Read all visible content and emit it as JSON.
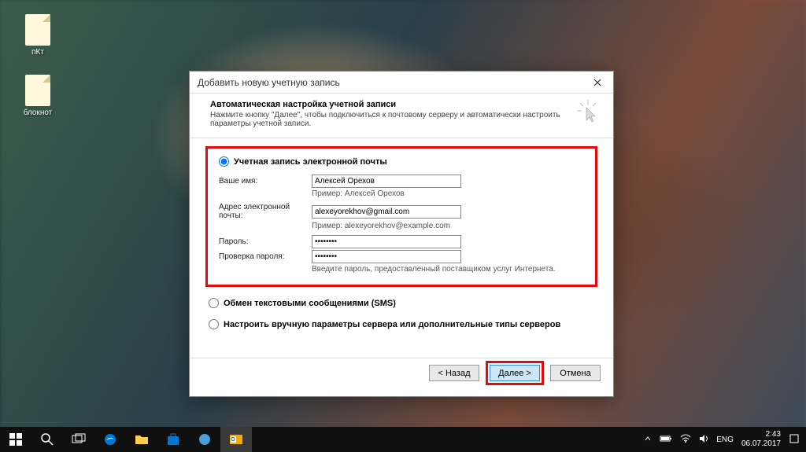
{
  "desktop": {
    "icons": [
      "пКт",
      "блокнот"
    ]
  },
  "dialog": {
    "title": "Добавить новую учетную запись",
    "header_title": "Автоматическая настройка учетной записи",
    "header_sub": "Нажмите кнопку \"Далее\", чтобы подключиться к почтовому серверу и автоматически настроить параметры учетной записи.",
    "radio_email": "Учетная запись электронной почты",
    "form": {
      "name_label": "Ваше имя:",
      "name_value": "Алексей Орехов",
      "name_hint": "Пример: Алексей Орехов",
      "email_label": "Адрес электронной почты:",
      "email_value": "alexeyorekhov@gmail.com",
      "email_hint": "Пример: alexeyorekhov@example.com",
      "password_label": "Пароль:",
      "password_value": "********",
      "password2_label": "Проверка пароля:",
      "password2_value": "********",
      "password_hint": "Введите пароль, предоставленный поставщиком услуг Интернета."
    },
    "radio_sms": "Обмен текстовыми сообщениями (SMS)",
    "radio_manual": "Настроить вручную параметры сервера или дополнительные типы серверов",
    "buttons": {
      "back": "< Назад",
      "next": "Далее >",
      "cancel": "Отмена"
    }
  },
  "taskbar": {
    "lang": "ENG",
    "time": "2:43",
    "date": "06.07.2017"
  }
}
